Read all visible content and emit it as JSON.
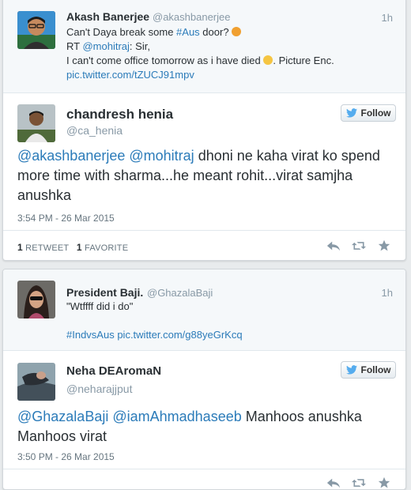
{
  "cards": {
    "first": {
      "context": {
        "name": "Akash Banerjee",
        "handle": "@akashbanerjee",
        "time": "1h",
        "line1_text": "Can't Daya break some ",
        "line1_hashtag": "#Aus",
        "line1_text2": " door?",
        "line2_prefix": "RT ",
        "line2_mention": "@mohitraj",
        "line2_text": ": Sir,",
        "line3_text": "I can't come office tomorrow as i have died",
        "line3_text2": ". Picture Enc.",
        "link": "pic.twitter.com/tZUCJ91mpv"
      },
      "tweet": {
        "name": "chandresh henia",
        "handle": "@ca_henia",
        "follow_label": "Follow",
        "mention1": "@akashbanerjee",
        "mention2": "@mohitraj",
        "text": " dhoni ne kaha virat ko spend more time with sharma...he meant rohit...virat samjha anushka",
        "timestamp": "3:54 PM - 26 Mar 2015",
        "retweet_count": "1",
        "retweet_label": "RETWEET",
        "favorite_count": "1",
        "favorite_label": "FAVORITE"
      }
    },
    "second": {
      "context": {
        "name": "President Baji.",
        "handle": "@GhazalaBaji",
        "time": "1h",
        "line1": "\"Wtffff did i do\"",
        "hashtag": "#IndvsAus",
        "link": "pic.twitter.com/g88yeGrKcq"
      },
      "tweet": {
        "name": "Neha DEAromaN",
        "handle": "@neharajjput",
        "follow_label": "Follow",
        "mention1": "@GhazalaBaji",
        "mention2": "@iamAhmadhaseeb",
        "text": " Manhoos anushka Manhoos virat",
        "timestamp": "3:50 PM - 26 Mar 2015"
      }
    }
  },
  "colors": {
    "link": "#2b7bb9",
    "muted": "#8899a6",
    "text": "#292f33",
    "page_bg": "#e8ebed"
  }
}
